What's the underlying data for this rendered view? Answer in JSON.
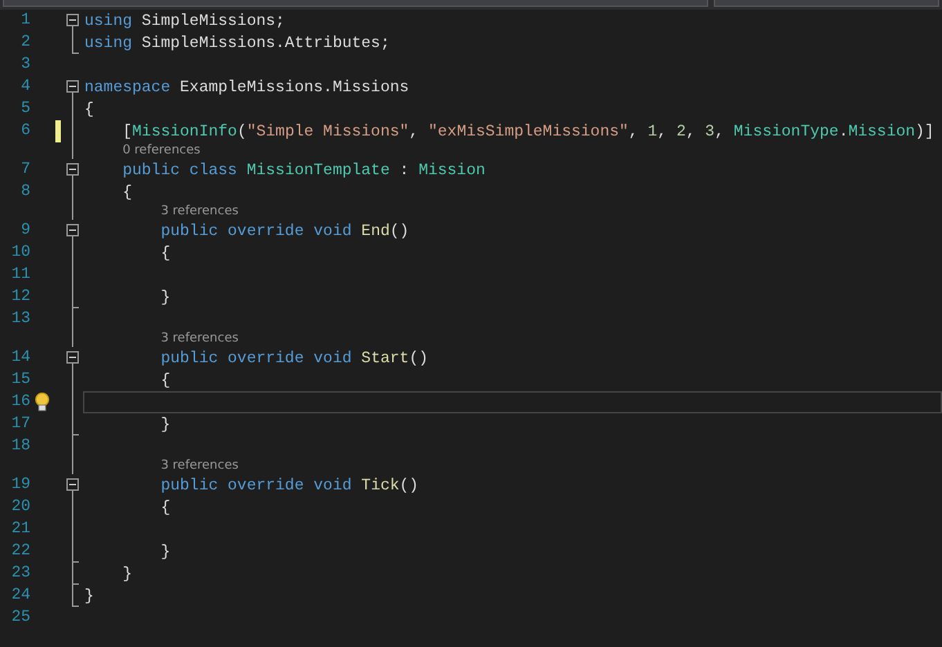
{
  "editor": {
    "lines": [
      {
        "number": "1",
        "kind": "opener",
        "tokens": [
          {
            "kind": "keyword",
            "text": "using"
          },
          {
            "kind": "plain",
            "text": " SimpleMissions;"
          }
        ]
      },
      {
        "number": "2",
        "kind": "closer",
        "tokens": [
          {
            "kind": "keyword",
            "text": "using"
          },
          {
            "kind": "plain",
            "text": " SimpleMissions.Attributes;"
          }
        ]
      },
      {
        "number": "3",
        "kind": "outer"
      },
      {
        "number": "4",
        "kind": "opener",
        "tokens": [
          {
            "kind": "keyword",
            "text": "namespace"
          },
          {
            "kind": "plain",
            "text": " ExampleMissions.Missions"
          }
        ]
      },
      {
        "number": "5",
        "kind": "inner",
        "tokens": [
          {
            "kind": "plain",
            "text": "{"
          }
        ]
      },
      {
        "number": "6",
        "kind": "inner",
        "modified": true,
        "tokens": [
          {
            "kind": "plain",
            "text": "    ["
          },
          {
            "kind": "type",
            "text": "MissionInfo"
          },
          {
            "kind": "plain",
            "text": "("
          },
          {
            "kind": "string",
            "text": "\"Simple Missions\""
          },
          {
            "kind": "plain",
            "text": ", "
          },
          {
            "kind": "string",
            "text": "\"exMisSimpleMissions\""
          },
          {
            "kind": "plain",
            "text": ", "
          },
          {
            "kind": "number",
            "text": "1"
          },
          {
            "kind": "plain",
            "text": ", "
          },
          {
            "kind": "number",
            "text": "2"
          },
          {
            "kind": "plain",
            "text": ", "
          },
          {
            "kind": "number",
            "text": "3"
          },
          {
            "kind": "plain",
            "text": ", "
          },
          {
            "kind": "type",
            "text": "MissionType"
          },
          {
            "kind": "plain",
            "text": "."
          },
          {
            "kind": "type",
            "text": "Mission"
          },
          {
            "kind": "plain",
            "text": ")]"
          }
        ]
      },
      {
        "number": "7",
        "kind": "opener",
        "codelens": "0 references",
        "tokens": [
          {
            "kind": "keyword",
            "text": "    public"
          },
          {
            "kind": "keyword",
            "text": " class"
          },
          {
            "kind": "type",
            "text": " MissionTemplate"
          },
          {
            "kind": "plain",
            "text": " : "
          },
          {
            "kind": "type",
            "text": "Mission"
          }
        ]
      },
      {
        "number": "8",
        "kind": "inner",
        "tokens": [
          {
            "kind": "plain",
            "text": "    {"
          }
        ]
      },
      {
        "number": "9",
        "kind": "opener",
        "codelens": "3 references",
        "tokens": [
          {
            "kind": "keyword",
            "text": "        public"
          },
          {
            "kind": "keyword",
            "text": " override"
          },
          {
            "kind": "keyword",
            "text": " void"
          },
          {
            "kind": "method",
            "text": " End"
          },
          {
            "kind": "plain",
            "text": "()"
          }
        ]
      },
      {
        "number": "10",
        "kind": "inner",
        "tokens": [
          {
            "kind": "plain",
            "text": "        {"
          }
        ]
      },
      {
        "number": "11",
        "kind": "inner"
      },
      {
        "number": "12",
        "kind": "closer",
        "tokens": [
          {
            "kind": "plain",
            "text": "        }"
          }
        ]
      },
      {
        "number": "13",
        "kind": "inner"
      },
      {
        "number": "14",
        "kind": "opener",
        "codelens": "3 references",
        "tokens": [
          {
            "kind": "keyword",
            "text": "        public"
          },
          {
            "kind": "keyword",
            "text": " override"
          },
          {
            "kind": "keyword",
            "text": " void"
          },
          {
            "kind": "method",
            "text": " Start"
          },
          {
            "kind": "plain",
            "text": "()"
          }
        ]
      },
      {
        "number": "15",
        "kind": "inner",
        "tokens": [
          {
            "kind": "plain",
            "text": "        {"
          }
        ]
      },
      {
        "number": "16",
        "kind": "inner",
        "current": true,
        "lightbulb": true
      },
      {
        "number": "17",
        "kind": "closer",
        "tokens": [
          {
            "kind": "plain",
            "text": "        }"
          }
        ]
      },
      {
        "number": "18",
        "kind": "inner"
      },
      {
        "number": "19",
        "kind": "opener",
        "codelens": "3 references",
        "tokens": [
          {
            "kind": "keyword",
            "text": "        public"
          },
          {
            "kind": "keyword",
            "text": " override"
          },
          {
            "kind": "keyword",
            "text": " void"
          },
          {
            "kind": "method",
            "text": " Tick"
          },
          {
            "kind": "plain",
            "text": "()"
          }
        ]
      },
      {
        "number": "20",
        "kind": "inner",
        "tokens": [
          {
            "kind": "plain",
            "text": "        {"
          }
        ]
      },
      {
        "number": "21",
        "kind": "inner"
      },
      {
        "number": "22",
        "kind": "closer",
        "tokens": [
          {
            "kind": "plain",
            "text": "        }"
          }
        ]
      },
      {
        "number": "23",
        "kind": "closer",
        "tokens": [
          {
            "kind": "plain",
            "text": "    }"
          }
        ]
      },
      {
        "number": "24",
        "kind": "closer",
        "tokens": [
          {
            "kind": "plain",
            "text": "}"
          }
        ]
      },
      {
        "number": "25",
        "kind": "outer"
      }
    ]
  }
}
